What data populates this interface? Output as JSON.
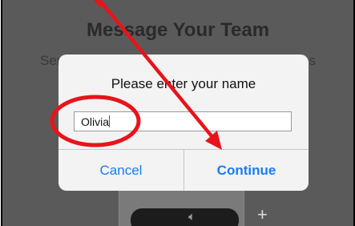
{
  "background": {
    "title": "Message Your Team",
    "subtitle": "Send texts, voice messages, files and images",
    "plus": "+"
  },
  "dialog": {
    "prompt": "Please enter your name",
    "input_value": "Olivia",
    "cancel_label": "Cancel",
    "continue_label": "Continue"
  },
  "colors": {
    "accent": "#1a7cf0",
    "annotation": "#e8141b"
  }
}
